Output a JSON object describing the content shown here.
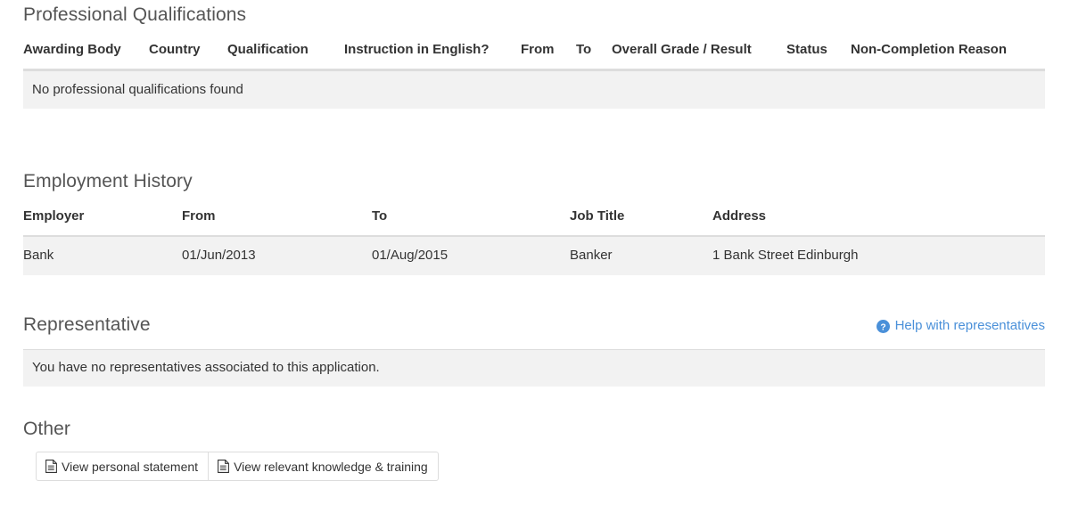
{
  "professional_qualifications": {
    "heading": "Professional Qualifications",
    "columns": [
      "Awarding Body",
      "Country",
      "Qualification",
      "Instruction in English?",
      "From",
      "To",
      "Overall Grade / Result",
      "Status",
      "Non-Completion Reason"
    ],
    "empty_message": "No professional qualifications found",
    "rows": []
  },
  "employment_history": {
    "heading": "Employment History",
    "columns": [
      "Employer",
      "From",
      "To",
      "Job Title",
      "Address"
    ],
    "rows": [
      {
        "employer": "Bank",
        "from": "01/Jun/2013",
        "to": "01/Aug/2015",
        "job_title": "Banker",
        "address": "1 Bank Street Edinburgh"
      }
    ]
  },
  "representative": {
    "heading": "Representative",
    "help_link": {
      "label": "Help with representatives",
      "icon": "question-circle-icon"
    },
    "empty_message": "You have no representatives associated to this application."
  },
  "other": {
    "heading": "Other",
    "buttons": [
      {
        "label": "View personal statement",
        "icon": "file-text-icon"
      },
      {
        "label": "View relevant knowledge & training",
        "icon": "file-text-icon"
      }
    ]
  },
  "colors": {
    "link": "#4a90d9",
    "stripe": "#f2f2f2",
    "border": "#dddddd",
    "heading": "#555555",
    "text": "#333333"
  }
}
